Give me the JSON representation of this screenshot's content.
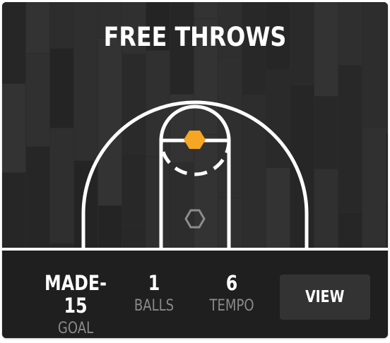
{
  "card": {
    "title": "FREE THROWS"
  },
  "court": {
    "line_color": "#ffffff",
    "active_marker_color": "#f5a623",
    "inactive_marker_color": "#8c8c8c",
    "floor_color": "#2b2b2b"
  },
  "stats": {
    "made": {
      "value": "MADE-15",
      "label": "GOAL"
    },
    "balls": {
      "value": "1",
      "label": "BALLS"
    },
    "tempo": {
      "value": "6",
      "label": "TEMPO"
    }
  },
  "actions": {
    "view_label": "VIEW"
  }
}
